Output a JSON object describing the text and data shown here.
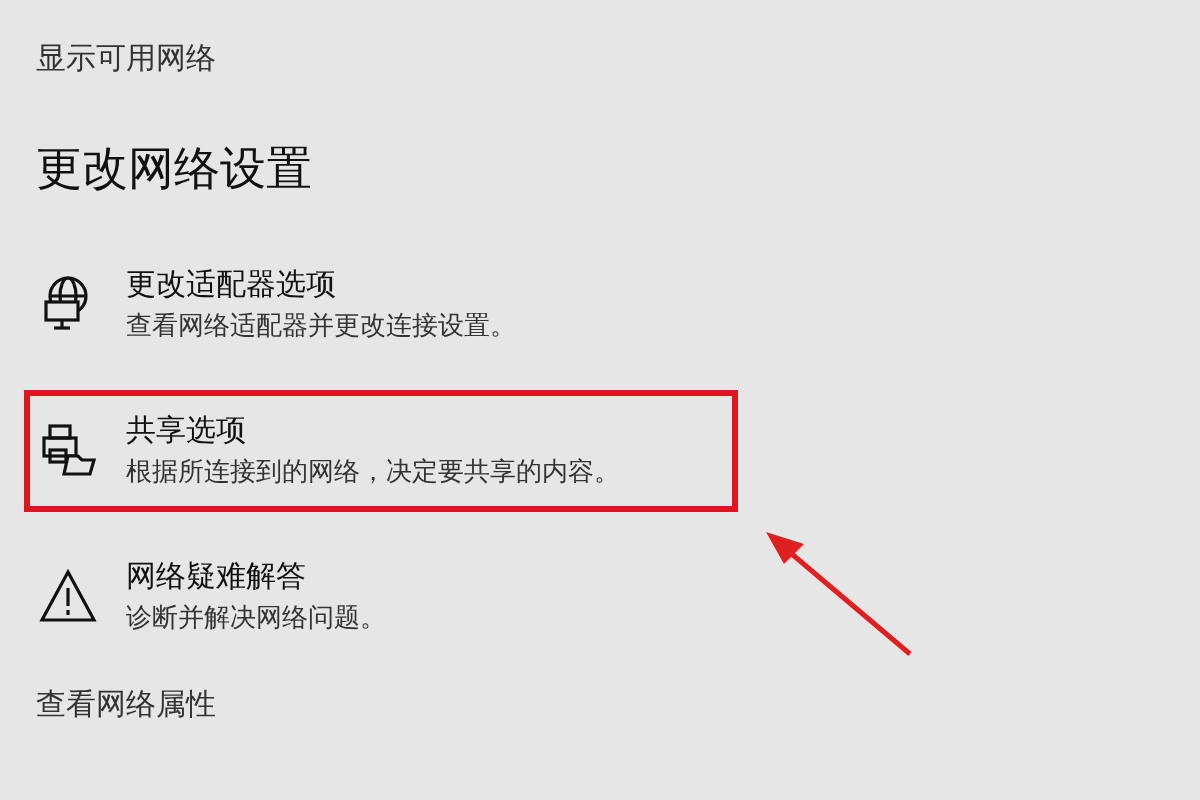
{
  "top_link": "显示可用网络",
  "heading": "更改网络设置",
  "items": [
    {
      "kind": "adapter",
      "title": "更改适配器选项",
      "description": "查看网络适配器并更改连接设置。",
      "highlighted": false
    },
    {
      "kind": "sharing",
      "title": "共享选项",
      "description": "根据所连接到的网络，决定要共享的内容。",
      "highlighted": true
    },
    {
      "kind": "troubleshoot",
      "title": "网络疑难解答",
      "description": "诊断并解决网络问题。",
      "highlighted": false
    }
  ],
  "bottom_link": "查看网络属性"
}
